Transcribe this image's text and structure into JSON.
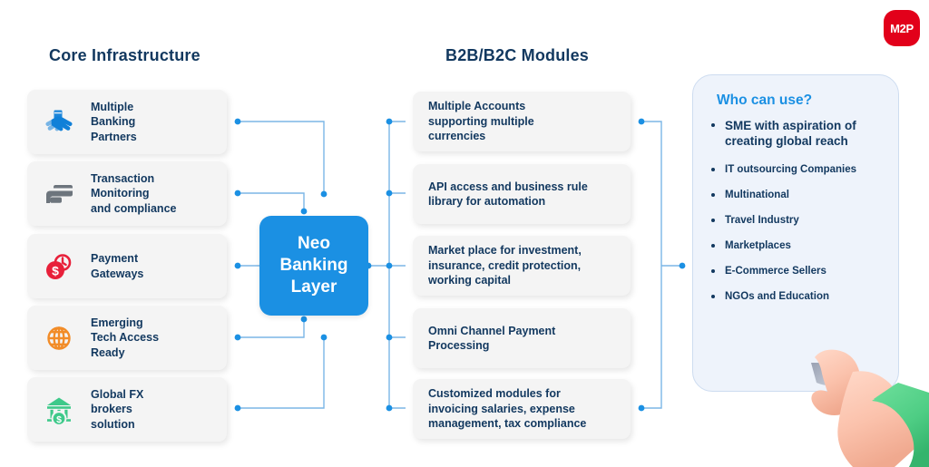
{
  "brand": {
    "logo_text": "M2P",
    "logo_color": "#e2001a"
  },
  "colors": {
    "heading": "#12385f",
    "accent_blue": "#1b90e3",
    "panel_bg": "#eef3fb",
    "panel_border": "#cddcf0",
    "card_bg": "#f4f4f4",
    "connector": "#7bb6e6",
    "icon_blue": "#1180d8",
    "icon_gray": "#6d757d",
    "icon_red": "#e8203a",
    "icon_orange": "#f28c28",
    "icon_green": "#3ec98a"
  },
  "columns": {
    "core": {
      "title": "Core Infrastructure",
      "items": [
        {
          "label": "Multiple\nBanking\nPartners",
          "icon": "handshake-icon"
        },
        {
          "label": "Transaction\nMonitoring\nand compliance",
          "icon": "hand-card-icon"
        },
        {
          "label": "Payment\nGateways",
          "icon": "clock-dollar-icon"
        },
        {
          "label": "Emerging\nTech Access\nReady",
          "icon": "globe-icon"
        },
        {
          "label": "Global FX\nbrokers\nsolution",
          "icon": "bank-dollar-icon"
        }
      ]
    },
    "modules": {
      "title": "B2B/B2C Modules",
      "items": [
        {
          "label": "Multiple Accounts\nsupporting multiple\ncurrencies"
        },
        {
          "label": "API access and business rule\nlibrary for automation"
        },
        {
          "label": "Market place for investment,\ninsurance, credit protection,\nworking capital"
        },
        {
          "label": "Omni Channel Payment\nProcessing"
        },
        {
          "label": "Customized modules for\ninvoicing salaries, expense\nmanagement, tax compliance"
        }
      ]
    }
  },
  "center": {
    "label": "Neo\nBanking\nLayer"
  },
  "who_can_use": {
    "title": "Who can use?",
    "items": [
      "SME with aspiration of creating global reach",
      "IT outsourcing Companies",
      "Multinational",
      "Travel Industry",
      "Marketplaces",
      "E-Commerce Sellers",
      "NGOs and Education"
    ]
  }
}
